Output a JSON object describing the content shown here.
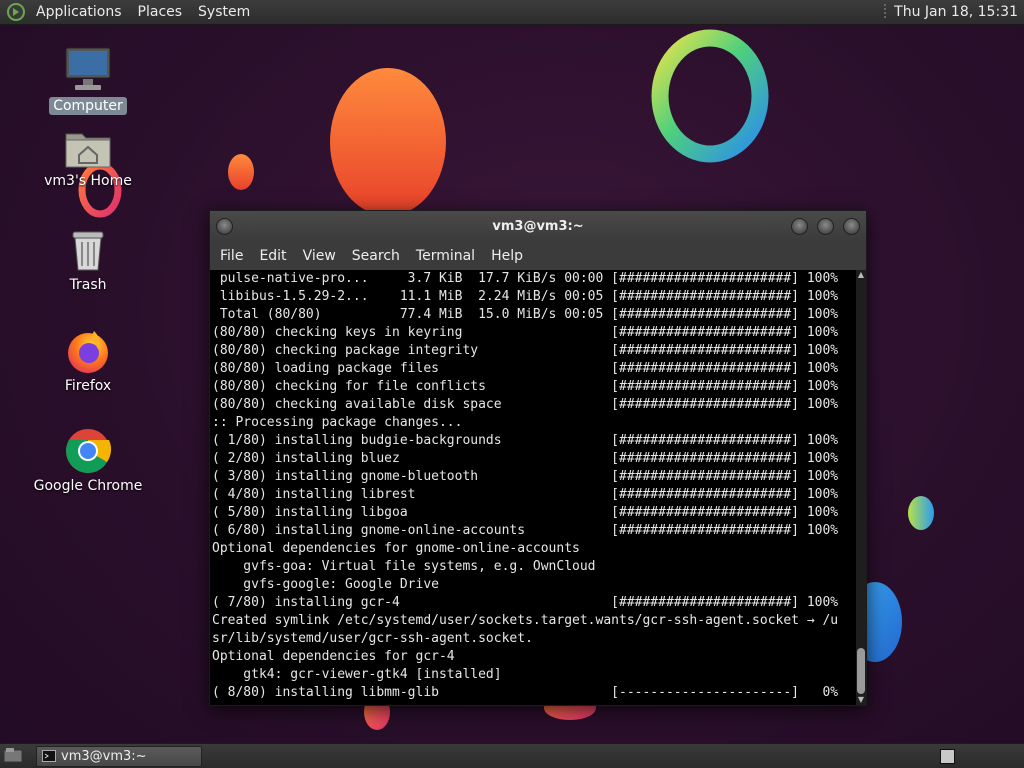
{
  "top_panel": {
    "menus": [
      "Applications",
      "Places",
      "System"
    ],
    "clock": "Thu Jan 18, 15:31",
    "logo_icon": "mate-logo-icon"
  },
  "desktop_icons": [
    {
      "label": "Computer",
      "icon": "computer-icon",
      "selected": true
    },
    {
      "label": "vm3's Home",
      "icon": "home-folder-icon",
      "selected": false
    },
    {
      "label": "Trash",
      "icon": "trash-icon",
      "selected": false
    },
    {
      "label": "Firefox",
      "icon": "firefox-icon",
      "selected": false
    },
    {
      "label": "Google Chrome",
      "icon": "chrome-icon",
      "selected": false
    }
  ],
  "terminal": {
    "title": "vm3@vm3:~",
    "menu": [
      "File",
      "Edit",
      "View",
      "Search",
      "Terminal",
      "Help"
    ],
    "lines": [
      " pulse-native-pro...     3.7 KiB  17.7 KiB/s 00:00 [######################] 100%",
      " libibus-1.5.29-2...    11.1 MiB  2.24 MiB/s 00:05 [######################] 100%",
      " Total (80/80)          77.4 MiB  15.0 MiB/s 00:05 [######################] 100%",
      "(80/80) checking keys in keyring                   [######################] 100%",
      "(80/80) checking package integrity                 [######################] 100%",
      "(80/80) loading package files                      [######################] 100%",
      "(80/80) checking for file conflicts                [######################] 100%",
      "(80/80) checking available disk space              [######################] 100%",
      ":: Processing package changes...",
      "( 1/80) installing budgie-backgrounds              [######################] 100%",
      "( 2/80) installing bluez                           [######################] 100%",
      "( 3/80) installing gnome-bluetooth                 [######################] 100%",
      "( 4/80) installing librest                         [######################] 100%",
      "( 5/80) installing libgoa                          [######################] 100%",
      "( 6/80) installing gnome-online-accounts           [######################] 100%",
      "Optional dependencies for gnome-online-accounts",
      "    gvfs-goa: Virtual file systems, e.g. OwnCloud",
      "    gvfs-google: Google Drive",
      "( 7/80) installing gcr-4                           [######################] 100%",
      "Created symlink /etc/systemd/user/sockets.target.wants/gcr-ssh-agent.socket → /u",
      "sr/lib/systemd/user/gcr-ssh-agent.socket.",
      "Optional dependencies for gcr-4",
      "    gtk4: gcr-viewer-gtk4 [installed]",
      "( 8/80) installing libmm-glib                      [----------------------]   0%"
    ]
  },
  "taskbar": {
    "task_label": "vm3@vm3:~",
    "task_icon": "terminal-icon",
    "show_desktop_icon": "show-desktop-icon"
  },
  "colors": {
    "background": "#2a0f2b",
    "panel": "#333333",
    "selection": "#7d8a96",
    "terminal_bg": "#000000"
  }
}
